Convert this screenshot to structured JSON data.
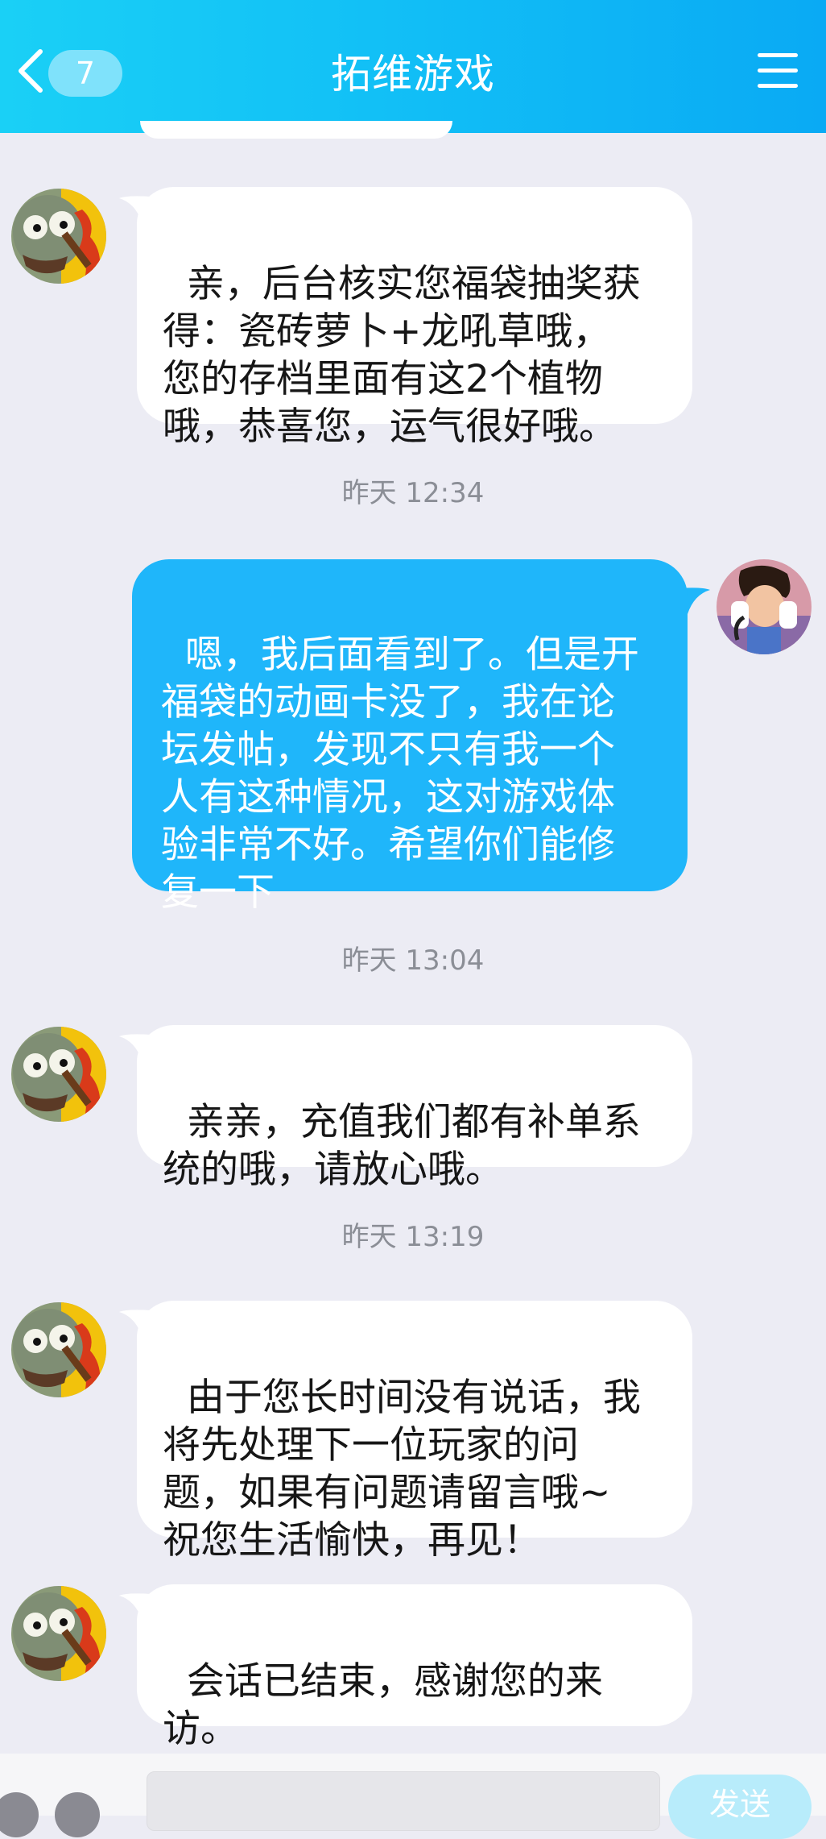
{
  "header": {
    "title": "拓维游戏",
    "unread_count": "7",
    "back_icon": "chevron-left-icon",
    "menu_icon": "hamburger-menu-icon"
  },
  "messages": [
    {
      "sender": "agent",
      "text": "亲，后台核实您福袋抽奖获\n得：瓷砖萝卜+龙吼草哦，\n您的存档里面有这2个植物\n哦，恭喜您，运气很好哦。"
    },
    {
      "type": "timestamp",
      "text": "昨天 12:34"
    },
    {
      "sender": "user",
      "text": "嗯，我后面看到了。但是开\n福袋的动画卡没了，我在论\n坛发帖，发现不只有我一个\n人有这种情况，这对游戏体\n验非常不好。希望你们能修\n复一下"
    },
    {
      "type": "timestamp",
      "text": "昨天 13:04"
    },
    {
      "sender": "agent",
      "text": "亲亲，充值我们都有补单系\n统的哦，请放心哦。"
    },
    {
      "type": "timestamp",
      "text": "昨天 13:19"
    },
    {
      "sender": "agent",
      "text": "由于您长时间没有说话，我\n将先处理下一位玩家的问\n题，如果有问题请留言哦~\n祝您生活愉快，再见！"
    },
    {
      "sender": "agent",
      "text": "会话已结束，感谢您的来\n访。"
    }
  ],
  "input_bar": {
    "send_label": "发送",
    "left_icons": [
      "voice-icon",
      "add-icon"
    ]
  },
  "colors": {
    "header_start": "#1ad0f6",
    "header_end": "#0aaaf4",
    "outgoing_bubble": "#1fb6fa",
    "incoming_bubble": "#ffffff",
    "background": "#ececf4",
    "timestamp": "#8b8e96"
  }
}
